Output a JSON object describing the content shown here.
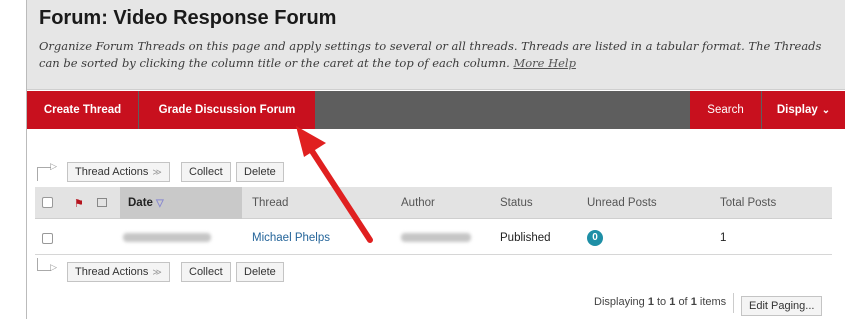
{
  "header": {
    "title": "Forum: Video Response Forum",
    "description": "Organize Forum Threads on this page and apply settings to several or all threads. Threads are listed in a tabular format. The Threads can be sorted by clicking the column title or the caret at the top of each column.",
    "help_link": "More Help"
  },
  "actionbar": {
    "create_thread": "Create Thread",
    "grade_forum": "Grade Discussion Forum",
    "search": "Search",
    "display": "Display"
  },
  "toolbar": {
    "thread_actions": "Thread Actions",
    "collect": "Collect",
    "delete": "Delete"
  },
  "table": {
    "columns": [
      "Date",
      "Thread",
      "Author",
      "Status",
      "Unread Posts",
      "Total Posts"
    ],
    "rows": [
      {
        "thread": "Michael Phelps",
        "status": "Published",
        "unread": "0",
        "total": "1"
      }
    ]
  },
  "pager": {
    "prefix": "Displaying",
    "from": "1",
    "to_word": "to",
    "to": "1",
    "of_word": "of",
    "total": "1",
    "suffix": "items",
    "edit_paging": "Edit Paging..."
  },
  "colors": {
    "accent_red": "#c8101e",
    "actionbar_gray": "#5e5e5e",
    "link_blue": "#25659a",
    "badge_teal": "#1e8fa6",
    "arrow_red": "#e02020"
  }
}
